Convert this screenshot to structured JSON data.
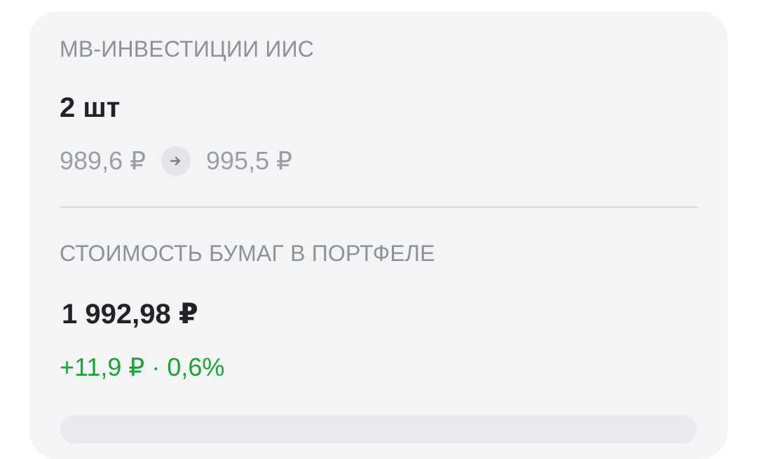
{
  "position": {
    "title": "МВ-ИНВЕСТИЦИИ ИИС",
    "quantity": "2 шт",
    "price_from": "989,6 ₽",
    "price_to": "995,5 ₽"
  },
  "portfolio": {
    "title": "СТОИМОСТЬ БУМАГ В ПОРТФЕЛЕ",
    "value": "1 992,98 ₽",
    "change": "+11,9 ₽ · 0,6%"
  },
  "colors": {
    "positive": "#1aa33b",
    "muted_text": "#8d9197",
    "card_bg": "#f3f4f6"
  },
  "icons": {
    "price_change": "arrow-right-icon"
  }
}
